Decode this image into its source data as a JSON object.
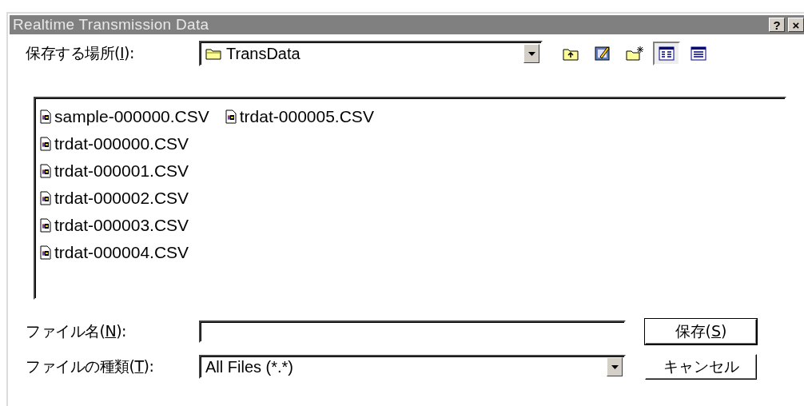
{
  "window": {
    "title": "Realtime Transmission Data",
    "help_button": "?",
    "close_button": "×"
  },
  "save_in": {
    "label": {
      "before": "保存する場所(",
      "key": "I",
      "after": "):"
    },
    "value": "TransData"
  },
  "toolbar": [
    {
      "kind": "up",
      "selected": false
    },
    {
      "kind": "desktop",
      "selected": false
    },
    {
      "kind": "newfolder",
      "selected": false
    },
    {
      "kind": "list",
      "selected": true
    },
    {
      "kind": "details",
      "selected": false
    }
  ],
  "files": [
    {
      "name": "sample-000000.CSV"
    },
    {
      "name": "trdat-000000.CSV"
    },
    {
      "name": "trdat-000001.CSV"
    },
    {
      "name": "trdat-000002.CSV"
    },
    {
      "name": "trdat-000003.CSV"
    },
    {
      "name": "trdat-000004.CSV"
    },
    {
      "name": "trdat-000005.CSV"
    }
  ],
  "file_name": {
    "label": {
      "before": "ファイル名(",
      "key": "N",
      "after": "):"
    }
  },
  "file_type": {
    "label": {
      "before": "ファイルの種類(",
      "key": "T",
      "after": "):"
    },
    "value": "All Files (*.*)"
  },
  "save_button": {
    "before": "保存(",
    "key": "S",
    "after": ")"
  },
  "cancel_button": "キャンセル"
}
